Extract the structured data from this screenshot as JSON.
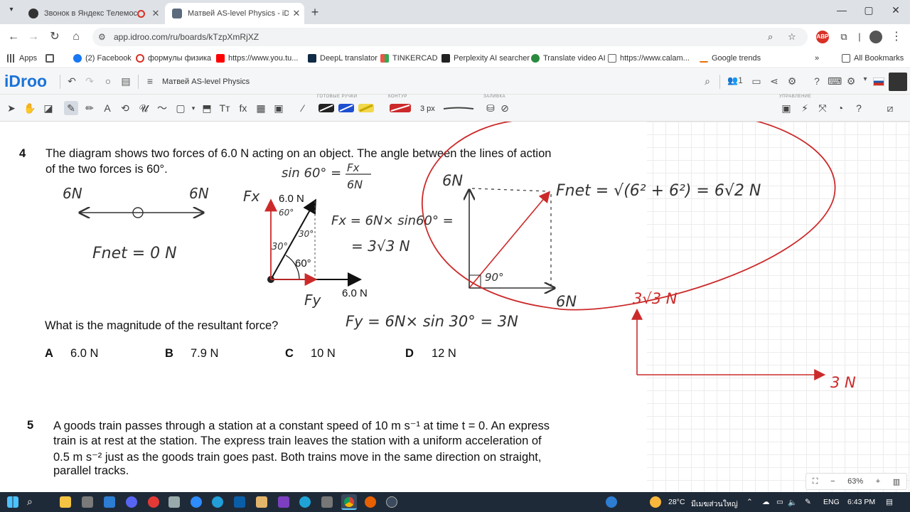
{
  "browser": {
    "tabs": [
      {
        "title": "Звонок в Яндекс Телемост",
        "active": false
      },
      {
        "title": "Матвей AS-level Physics - iDroo",
        "active": true
      }
    ],
    "url": "app.idroo.com/ru/boards/kTzpXmRjXZ",
    "bookmarks": [
      "Apps",
      "(2) Facebook",
      "формулы физика",
      "https://www.you.tu...",
      "DeepL translator",
      "TINKERCAD",
      "Perplexity AI searcher",
      "Translate video AI",
      "https://www.calam...",
      "Google trends"
    ],
    "all_bookmarks": "All Bookmarks"
  },
  "app": {
    "logo": "iDroo",
    "board_name": "Матвей AS-level Physics",
    "user_count": "1",
    "group_labels": {
      "ready_pens": "ГОТОВЫЕ РУЧКИ",
      "contour": "КОНТУР",
      "fill": "ЗАЛИВКА",
      "control": "УПРАВЛЕНИЕ"
    },
    "stroke_size": "3 px",
    "zoom": "63%"
  },
  "question4": {
    "number": "4",
    "line1": "The diagram shows two forces of 6.0 N acting on an object. The angle between the lines of action",
    "line2": "of the two forces is 60°.",
    "diagram_label_top": "6.0 N",
    "diagram_label_right": "6.0 N",
    "diagram_angle": "60°",
    "question": "What is the magnitude of the resultant force?",
    "options": [
      {
        "key": "A",
        "value": "6.0 N"
      },
      {
        "key": "B",
        "value": "7.9 N"
      },
      {
        "key": "C",
        "value": "10 N"
      },
      {
        "key": "D",
        "value": "12 N"
      }
    ]
  },
  "question5": {
    "number": "5",
    "line1": "A goods train passes through a station at a constant speed of 10 m s⁻¹ at time t = 0. An express",
    "line2": "train is at rest at the station. The express train leaves the station with a uniform acceleration of",
    "line3": "0.5 m s⁻² just as the goods train goes past. Both trains move in the same direction on straight,",
    "line4": "parallel tracks."
  },
  "handwriting": {
    "six_n_left": "6N",
    "six_n_right": "6N",
    "fnet_zero": "Fnet = 0 N",
    "sin60_lhs": "sin 60° =",
    "sin60_num": "Fx",
    "sin60_den": "6N",
    "fx_label": "Fx",
    "fy_label": "Fy",
    "angle_60": "60°",
    "angle_30a": "30°",
    "angle_30b": "30°",
    "fx_eq": "Fx = 6N× sin60° =",
    "fx_result": "= 3√3 N",
    "fy_eq": "Fy = 6N× sin 30° = 3N",
    "right_6n_top": "6N",
    "right_6n_bottom": "6N",
    "angle_90": "90°",
    "fnet_eq": "Fnet = √(6² + 6²) = 6√2  N",
    "red_3root3": "3√3 N",
    "red_3n": "3 N"
  },
  "taskbar": {
    "weather": "28°C",
    "location": "มีเมฆส่วนใหญ่",
    "lang": "ENG",
    "time": "6:43 PM"
  },
  "colors": {
    "brand": "#1a73d9",
    "annotation_red": "#cc2a2a",
    "taskbar": "#1f2a38"
  }
}
